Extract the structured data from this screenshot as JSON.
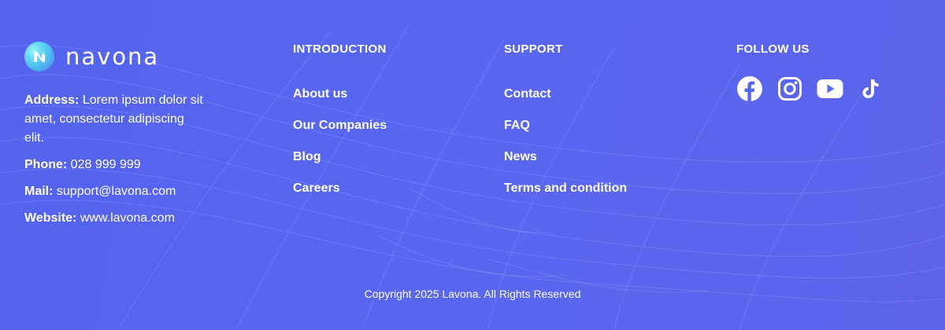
{
  "brand": {
    "name": "navona",
    "logo_icon": "navona-n-logo-icon",
    "accent_gradient": [
      "#8ef2f7",
      "#4a7ff0"
    ]
  },
  "theme": {
    "background": "#5867f1",
    "text": "#ffffff"
  },
  "contact": {
    "address_label": "Address:",
    "address_value": "Lorem ipsum dolor sit amet, consectetur adipiscing elit.",
    "phone_label": "Phone:",
    "phone_value": "028 999 999",
    "mail_label": "Mail:",
    "mail_value": "support@lavona.com",
    "website_label": "Website:",
    "website_value": "www.lavona.com"
  },
  "introduction": {
    "heading": "INTRODUCTION",
    "links": [
      "About us",
      "Our Companies",
      "Blog",
      "Careers"
    ]
  },
  "support": {
    "heading": "SUPPORT",
    "links": [
      "Contact",
      "FAQ",
      "News",
      "Terms and condition"
    ]
  },
  "follow": {
    "heading": "FOLLOW US",
    "icons": [
      "facebook-icon",
      "instagram-icon",
      "youtube-icon",
      "tiktok-icon"
    ]
  },
  "copyright": "Copyright 2025 Lavona. All Rights Reserved"
}
